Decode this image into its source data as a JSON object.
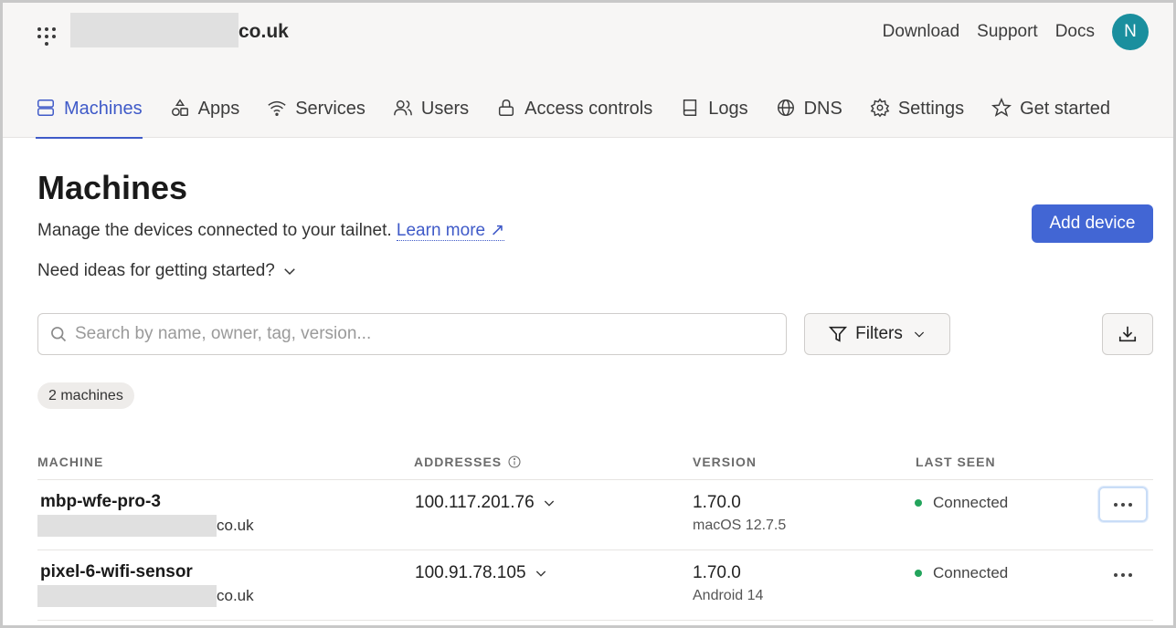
{
  "header": {
    "tenant_suffix": "co.uk",
    "links": [
      "Download",
      "Support",
      "Docs"
    ],
    "avatar_initial": "N"
  },
  "nav": {
    "tabs": [
      {
        "label": "Machines",
        "icon": "machines-icon",
        "active": true
      },
      {
        "label": "Apps",
        "icon": "apps-icon",
        "active": false
      },
      {
        "label": "Services",
        "icon": "wifi-icon",
        "active": false
      },
      {
        "label": "Users",
        "icon": "users-icon",
        "active": false
      },
      {
        "label": "Access controls",
        "icon": "lock-icon",
        "active": false
      },
      {
        "label": "Logs",
        "icon": "book-icon",
        "active": false
      },
      {
        "label": "DNS",
        "icon": "globe-icon",
        "active": false
      },
      {
        "label": "Settings",
        "icon": "gear-icon",
        "active": false
      },
      {
        "label": "Get started",
        "icon": "star-icon",
        "active": false
      }
    ]
  },
  "main": {
    "title": "Machines",
    "subtitle": "Manage the devices connected to your tailnet.",
    "learn_more": "Learn more ↗",
    "ideas": "Need ideas for getting started?",
    "add_device": "Add device",
    "search_placeholder": "Search by name, owner, tag, version...",
    "filters": "Filters",
    "count": "2 machines"
  },
  "table": {
    "columns": [
      "MACHINE",
      "ADDRESSES",
      "VERSION",
      "LAST SEEN"
    ],
    "rows": [
      {
        "name": "mbp-wfe-pro-3",
        "suffix": "co.uk",
        "address": "100.117.201.76",
        "version": "1.70.0",
        "os": "macOS 12.7.5",
        "status": "Connected"
      },
      {
        "name": "pixel-6-wifi-sensor",
        "suffix": "co.uk",
        "address": "100.91.78.105",
        "version": "1.70.0",
        "os": "Android 14",
        "status": "Connected"
      }
    ]
  },
  "colors": {
    "accent": "#4266d4",
    "avatar": "#1a8f9e",
    "connected": "#23a45c"
  }
}
